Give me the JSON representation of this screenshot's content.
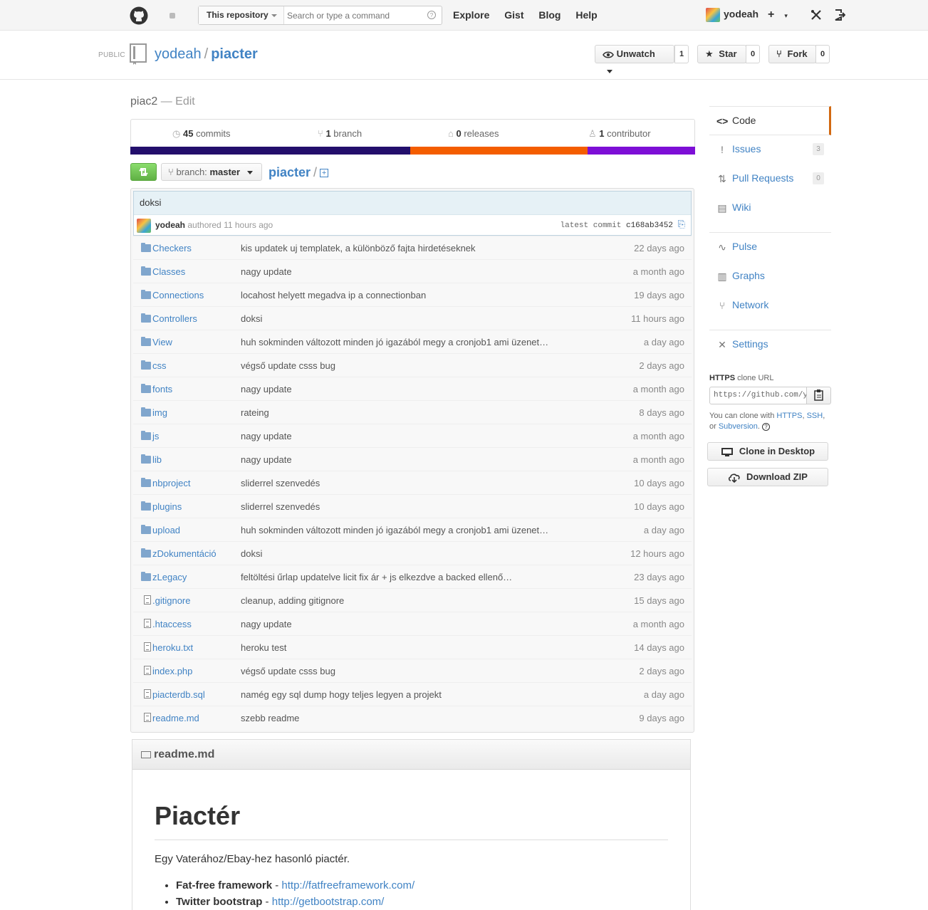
{
  "header": {
    "search_scope": "This repository",
    "search_placeholder": "Search or type a command",
    "nav": [
      "Explore",
      "Gist",
      "Blog",
      "Help"
    ],
    "username": "yodeah",
    "plus_label": "+"
  },
  "repo": {
    "visibility": "PUBLIC",
    "owner": "yodeah",
    "name": "piacter",
    "buttons": {
      "unwatch": "Unwatch",
      "unwatch_count": "1",
      "star": "Star",
      "star_count": "0",
      "fork": "Fork",
      "fork_count": "0"
    },
    "description": "piac2",
    "edit_label": " — Edit"
  },
  "summary": {
    "commits_count": "45",
    "commits_label": "commits",
    "branch_count": "1",
    "branch_label": "branch",
    "releases_count": "0",
    "releases_label": "releases",
    "contributor_count": "1",
    "contributor_label": "contributor"
  },
  "language_bar": [
    {
      "color": "#230f6c",
      "fraction": 0.495
    },
    {
      "color": "#f45d00",
      "fraction": 0.315
    },
    {
      "color": "#7d0fd6",
      "fraction": 0.19
    }
  ],
  "toolbar": {
    "branch_label": "branch:",
    "branch_name": "master",
    "breadcrumb_root": "piacter",
    "breadcrumb_sep": "/"
  },
  "commit": {
    "message": "doksi",
    "author": "yodeah",
    "authored_text": "authored 11 hours ago",
    "latest_label": "latest commit",
    "sha": "c168ab3452"
  },
  "files": [
    {
      "type": "dir",
      "name": "Checkers",
      "message": "kis updatek uj templatek, a különböző fajta hirdetéseknek",
      "age": "22 days ago"
    },
    {
      "type": "dir",
      "name": "Classes",
      "message": "nagy update",
      "age": "a month ago"
    },
    {
      "type": "dir",
      "name": "Connections",
      "message": "locahost helyett megadva ip a connectionban",
      "age": "19 days ago"
    },
    {
      "type": "dir",
      "name": "Controllers",
      "message": "doksi",
      "age": "11 hours ago"
    },
    {
      "type": "dir",
      "name": "View",
      "message": "huh sokminden változott minden jó igazából megy a cronjob1 ami üzenet…",
      "age": "a day ago"
    },
    {
      "type": "dir",
      "name": "css",
      "message": "végső update csss bug",
      "age": "2 days ago"
    },
    {
      "type": "dir",
      "name": "fonts",
      "message": "nagy update",
      "age": "a month ago"
    },
    {
      "type": "dir",
      "name": "img",
      "message": "rateing",
      "age": "8 days ago"
    },
    {
      "type": "dir",
      "name": "js",
      "message": "nagy update",
      "age": "a month ago"
    },
    {
      "type": "dir",
      "name": "lib",
      "message": "nagy update",
      "age": "a month ago"
    },
    {
      "type": "dir",
      "name": "nbproject",
      "message": "sliderrel szenvedés",
      "age": "10 days ago"
    },
    {
      "type": "dir",
      "name": "plugins",
      "message": "sliderrel szenvedés",
      "age": "10 days ago"
    },
    {
      "type": "dir",
      "name": "upload",
      "message": "huh sokminden változott minden jó igazából megy a cronjob1 ami üzenet…",
      "age": "a day ago"
    },
    {
      "type": "dir",
      "name": "zDokumentáció",
      "message": "doksi",
      "age": "12 hours ago"
    },
    {
      "type": "dir",
      "name": "zLegacy",
      "message": "feltöltési űrlap updatelve licit fix ár + js elkezdve a backed ellenő…",
      "age": "23 days ago"
    },
    {
      "type": "file",
      "name": ".gitignore",
      "message": "cleanup, adding gitignore",
      "age": "15 days ago"
    },
    {
      "type": "file",
      "name": ".htaccess",
      "message": "nagy update",
      "age": "a month ago"
    },
    {
      "type": "file",
      "name": "heroku.txt",
      "message": "heroku test",
      "age": "14 days ago"
    },
    {
      "type": "file",
      "name": "index.php",
      "message": "végső update csss bug",
      "age": "2 days ago"
    },
    {
      "type": "file",
      "name": "piacterdb.sql",
      "message": "namég egy sql dump hogy teljes legyen a projekt",
      "age": "a day ago"
    },
    {
      "type": "file",
      "name": "readme.md",
      "message": "szebb readme",
      "age": "9 days ago"
    }
  ],
  "readme": {
    "filename": "readme.md",
    "heading": "Piactér",
    "intro": "Egy Vaterához/Ebay-hez hasonló piactér.",
    "items": [
      {
        "name": "Fat-free framework",
        "sep": " - ",
        "url": "http://fatfreeframework.com/"
      },
      {
        "name": "Twitter bootstrap",
        "sep": " - ",
        "url": "http://getbootstrap.com/"
      }
    ]
  },
  "sidebar": {
    "items": [
      {
        "label": "Code",
        "icon": "code-icon",
        "glyph": "<>",
        "count": ""
      },
      {
        "label": "Issues",
        "icon": "issue-icon",
        "glyph": "!",
        "count": "3"
      },
      {
        "label": "Pull Requests",
        "icon": "pull-request-icon",
        "glyph": "⇅",
        "count": "0"
      },
      {
        "label": "Wiki",
        "icon": "book-icon",
        "glyph": "▤",
        "count": ""
      }
    ],
    "items2": [
      {
        "label": "Pulse",
        "icon": "pulse-icon",
        "glyph": "∿"
      },
      {
        "label": "Graphs",
        "icon": "graph-icon",
        "glyph": "▥"
      },
      {
        "label": "Network",
        "icon": "network-icon",
        "glyph": "⑂"
      }
    ],
    "items3": [
      {
        "label": "Settings",
        "icon": "tools-icon",
        "glyph": "✕"
      }
    ],
    "clone": {
      "protocol": "HTTPS",
      "label": "clone URL",
      "url": "https://github.com/yodeah/piacter.git",
      "help_prefix": "You can clone with ",
      "https": "HTTPS",
      "ssh": "SSH",
      "or": "or",
      "subversion": "Subversion",
      "comma": ",",
      "period": ".",
      "desktop_button": "Clone in Desktop",
      "zip_button": "Download ZIP"
    }
  }
}
